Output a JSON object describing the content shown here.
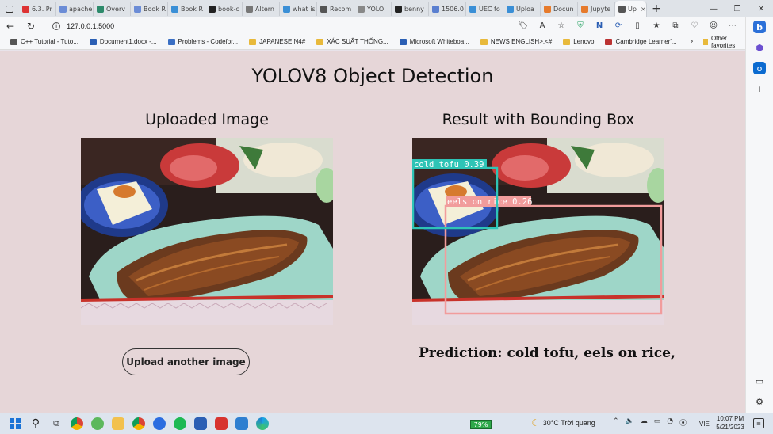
{
  "browser": {
    "tabs": [
      {
        "label": "6.3. Pr",
        "color": "#d33"
      },
      {
        "label": "apache",
        "color": "#6b8cd6"
      },
      {
        "label": "Overv",
        "color": "#2d8a6b"
      },
      {
        "label": "Book R",
        "color": "#6b8cd6"
      },
      {
        "label": "Book R",
        "color": "#3a8fd6"
      },
      {
        "label": "book-c",
        "color": "#222"
      },
      {
        "label": "Altern",
        "color": "#777"
      },
      {
        "label": "what is",
        "color": "#3a8fd6"
      },
      {
        "label": "Recom",
        "color": "#555"
      },
      {
        "label": "YOLO",
        "color": "#888"
      },
      {
        "label": "benny",
        "color": "#222"
      },
      {
        "label": "1506.0",
        "color": "#5a7fd0"
      },
      {
        "label": "UEC fo",
        "color": "#3a8fd6"
      },
      {
        "label": "Uploa",
        "color": "#3a8fd6"
      },
      {
        "label": "Docun",
        "color": "#e67a2b"
      },
      {
        "label": "Jupyte",
        "color": "#e67a2b"
      },
      {
        "label": "Up",
        "color": "#555",
        "active": true
      }
    ],
    "url": "127.0.0.1:5000",
    "bookmarks": [
      {
        "label": "C++ Tutorial - Tuto...",
        "type": "site",
        "color": "#555"
      },
      {
        "label": "Document1.docx -...",
        "type": "site",
        "color": "#2b5fb4"
      },
      {
        "label": "Problems - Codefor...",
        "type": "site",
        "color": "#3a6fc4"
      },
      {
        "label": "JAPANESE N4#",
        "type": "folder"
      },
      {
        "label": "XÁC SUẤT THỐNG...",
        "type": "folder"
      },
      {
        "label": "Microsoft Whiteboa...",
        "type": "site",
        "color": "#2b5fb4"
      },
      {
        "label": "NEWS ENGLISH>.<#",
        "type": "folder"
      },
      {
        "label": "Lenovo",
        "type": "folder"
      },
      {
        "label": "Cambridge Learner'...",
        "type": "site",
        "color": "#b33"
      }
    ],
    "other_favorites": "Other favorites"
  },
  "page": {
    "title": "YOLOV8 Object Detection",
    "uploaded_title": "Uploaded Image",
    "result_title": "Result with Bounding Box",
    "upload_button": "Upload another image",
    "prediction": "Prediction: cold tofu, eels on rice,",
    "detections": [
      {
        "label": "cold tofu 0.39",
        "color": "#2ec4b6"
      },
      {
        "label": "eels on rice 0.26",
        "color": "#f19c9c"
      }
    ]
  },
  "taskbar": {
    "battery": "79%",
    "weather": "30°C Trời quang",
    "lang": "VIE",
    "time": "10:07 PM",
    "date": "5/21/2023"
  }
}
